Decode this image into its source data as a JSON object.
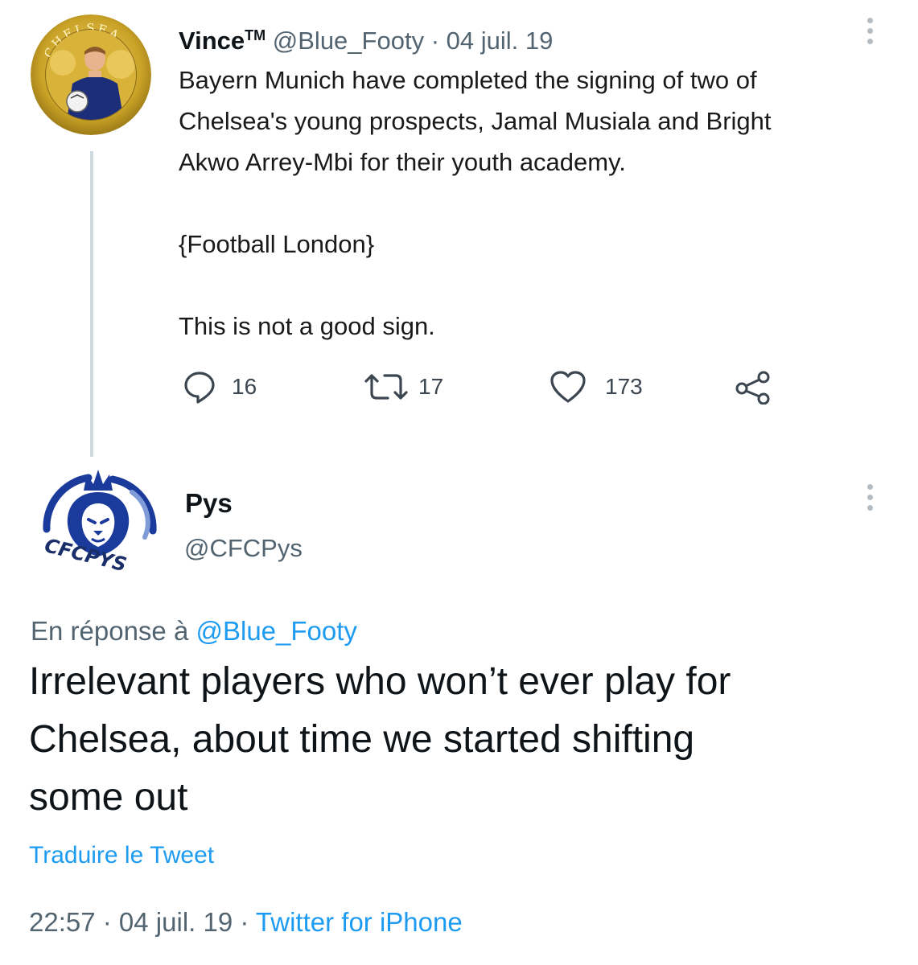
{
  "tweet_original": {
    "display_name": "Vince",
    "name_badge": "TM",
    "handle": "@Blue_Footy",
    "separator": " · ",
    "date": "04 juil. 19",
    "avatar_text": "CHELSEA",
    "body_lines": [
      "Bayern Munich have completed the signing of two of",
      "Chelsea's young prospects, Jamal Musiala and Bright",
      "Akwo Arrey-Mbi for their youth academy.",
      "",
      "{Football London}",
      "",
      "This is not a good sign."
    ],
    "actions": {
      "reply_count": "16",
      "retweet_count": "17",
      "like_count": "173",
      "reply_icon": "reply-icon",
      "retweet_icon": "retweet-icon",
      "like_icon": "heart-icon",
      "share_icon": "share-icon"
    },
    "more_icon": "more-vertical-icon"
  },
  "tweet_reply": {
    "display_name": "Pys",
    "handle": "@CFCPys",
    "avatar_text": "CFCPYS",
    "reply_prefix": "En réponse à ",
    "reply_mention": "@Blue_Footy",
    "body_lines": [
      "Irrelevant players who won’t ever play for",
      "Chelsea, about time we started shifting",
      "some out"
    ],
    "translate_label": "Traduire le Tweet",
    "time": "22:57",
    "separator": " · ",
    "date": "04 juil. 19",
    "source": "Twitter for iPhone",
    "more_icon": "more-vertical-icon"
  },
  "colors": {
    "text": "#0f1419",
    "secondary": "#536471",
    "link": "#1d9bf0",
    "thread_line": "#cfd9de",
    "chelsea_blue": "#1a3a9c",
    "crest_gold": "#c9a227"
  }
}
